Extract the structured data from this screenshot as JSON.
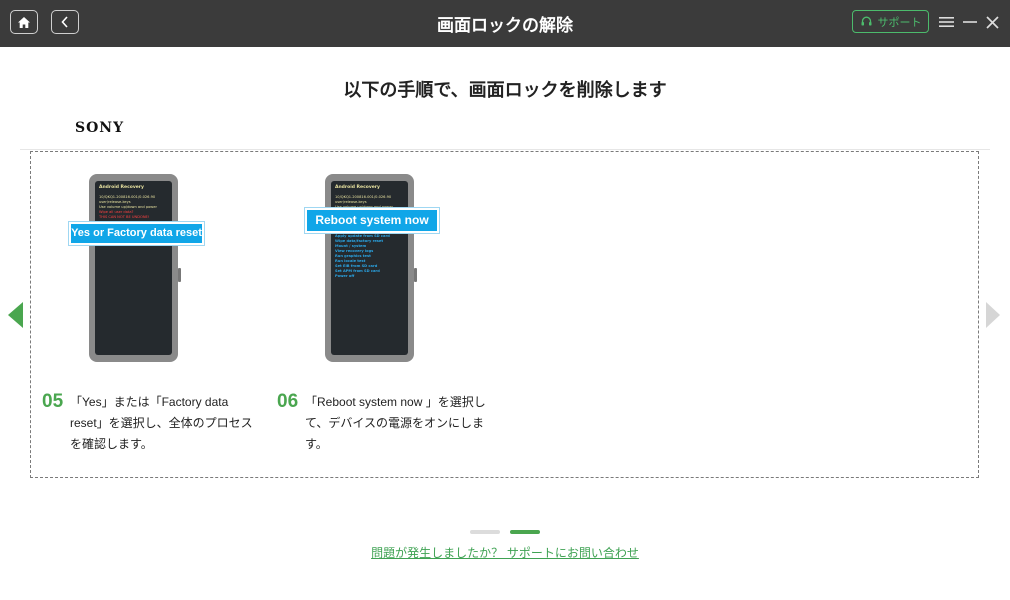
{
  "titlebar": {
    "title": "画面ロックの解除",
    "support_label": "サポート"
  },
  "main": {
    "heading": "以下の手順で、画面ロックを削除します",
    "brand": "SONY"
  },
  "steps": [
    {
      "number": "05",
      "text": "「Yes」または「Factory data reset」を選択し、全体のプロセスを確認します。",
      "callout": "Yes or Factory data reset",
      "screen_title": "Android Recovery",
      "screen_lines": [
        "10/QKQ1.200816.001/0.026.90",
        "user/release-keys",
        "Use volume up/down and power",
        "Wipe all user data?",
        "THIS CAN NOT BE UNDONE!"
      ]
    },
    {
      "number": "06",
      "text": "「Reboot system now 」を選択して、デバイスの電源をオンにします。",
      "callout": "Reboot system now",
      "screen_title": "Android Recovery",
      "screen_lines": [
        "10/QKQ1.200816.001/0.026.90",
        "user/release-keys",
        "Use volume up/down and power"
      ],
      "menu_items": [
        "Apply update from SD card",
        "Wipe data/factory reset",
        "Mount / system",
        "View recovery logs",
        "Run graphics test",
        "Run locale test",
        "Set EIB from SD card",
        "Set APM from SD card",
        "Power off"
      ]
    }
  ],
  "pagination": {
    "total": 2,
    "active": 2
  },
  "footer": {
    "help_link": "問題が発生しましたか？ サポートにお問い合わせ"
  },
  "colors": {
    "titlebar": "#3b3b3b",
    "accent_green": "#4aa64f",
    "callout_blue": "#10a6e8"
  },
  "icons": [
    "home-icon",
    "back-icon",
    "headset-icon",
    "menu-icon",
    "minimize-icon",
    "close-icon",
    "arrow-left-icon",
    "arrow-right-icon"
  ]
}
